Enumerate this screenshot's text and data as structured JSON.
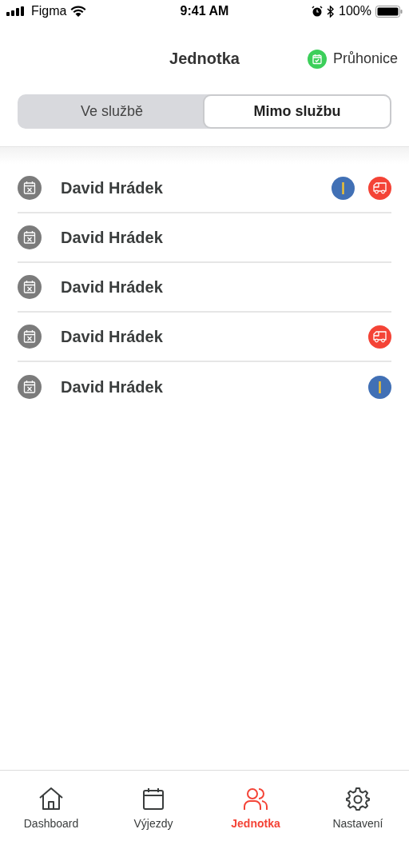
{
  "status_bar": {
    "carrier": "Figma",
    "time": "9:41 AM",
    "battery": "100%"
  },
  "header": {
    "title": "Jednotka",
    "location": "Průhonice"
  },
  "tabs": [
    {
      "label": "Ve službě",
      "selected": false
    },
    {
      "label": "Mimo službu",
      "selected": true
    }
  ],
  "members": [
    {
      "name": "David Hrádek",
      "badges": [
        {
          "kind": "unit"
        },
        {
          "kind": "vehicle"
        }
      ]
    },
    {
      "name": "David Hrádek"
    },
    {
      "name": "David Hrádek"
    },
    {
      "name": "David Hrádek",
      "badges": [
        {
          "kind": "vehicle"
        }
      ]
    },
    {
      "name": "David Hrádek",
      "badges": [
        {
          "kind": "unit"
        }
      ]
    }
  ],
  "nav": [
    {
      "kind": "home",
      "label": "Dashboard",
      "selected": false
    },
    {
      "kind": "calendar",
      "label": "Výjezdy",
      "selected": false
    },
    {
      "kind": "people",
      "label": "Jednotka",
      "selected": true
    },
    {
      "kind": "gear",
      "label": "Nastavení",
      "selected": false
    }
  ]
}
